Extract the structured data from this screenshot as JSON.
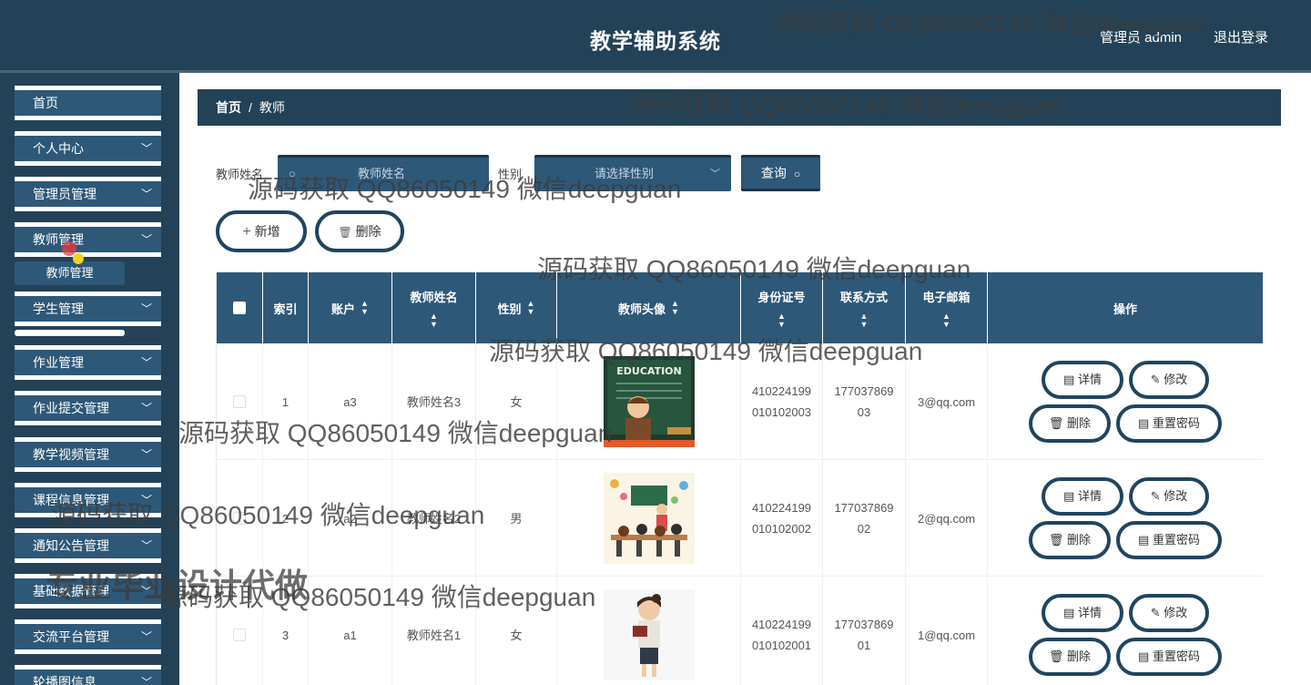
{
  "header": {
    "title": "教学辅助系统",
    "user": "管理员 admin",
    "logout": "退出登录"
  },
  "sidebar": {
    "items": [
      {
        "label": "首页",
        "chevron": false
      },
      {
        "label": "个人中心",
        "chevron": true
      },
      {
        "label": "管理员管理",
        "chevron": true
      },
      {
        "label": "教师管理",
        "chevron": true
      },
      {
        "label": "学生管理",
        "chevron": true
      },
      {
        "label": "作业管理",
        "chevron": true
      },
      {
        "label": "作业提交管理",
        "chevron": true
      },
      {
        "label": "教学视频管理",
        "chevron": true
      },
      {
        "label": "课程信息管理",
        "chevron": true
      },
      {
        "label": "通知公告管理",
        "chevron": true
      },
      {
        "label": "基础数据管理",
        "chevron": true
      },
      {
        "label": "交流平台管理",
        "chevron": true
      },
      {
        "label": "轮播图信息",
        "chevron": true
      }
    ],
    "sub_item": "教师管理",
    "chevron_icon": "chevron-down-icon"
  },
  "breadcrumb": {
    "home": "首页",
    "separator": "/",
    "current": "教师"
  },
  "search": {
    "name_label": "教师姓名",
    "name_placeholder": "教师姓名",
    "gender_label": "性别",
    "gender_placeholder": "请选择性别",
    "query_label": "查询"
  },
  "actions": {
    "add_label": "新增",
    "delete_label": "删除"
  },
  "table": {
    "columns": [
      "索引",
      "账户",
      "教师姓名",
      "性别",
      "教师头像",
      "身份证号",
      "联系方式",
      "电子邮箱",
      "操作"
    ],
    "rows": [
      {
        "index": "1",
        "account": "a3",
        "name": "教师姓名3",
        "gender": "女",
        "id_card": "410224199010102003",
        "phone": "17703786903",
        "email": "3@qq.com",
        "avatar": "education-board-teacher"
      },
      {
        "index": "2",
        "account": "a2",
        "name": "教师姓名2",
        "gender": "男",
        "id_card": "410224199010102002",
        "phone": "17703786902",
        "email": "2@qq.com",
        "avatar": "classroom-students"
      },
      {
        "index": "3",
        "account": "a1",
        "name": "教师姓名1",
        "gender": "女",
        "id_card": "410224199010102001",
        "phone": "17703786901",
        "email": "1@qq.com",
        "avatar": "female-teacher-book"
      }
    ],
    "op_labels": {
      "detail": "详情",
      "edit": "修改",
      "delete": "删除",
      "reset": "重置密码"
    },
    "avatar_board_text": "EDUCATION"
  },
  "watermarks": {
    "text": "源码获取 QQ86050149 微信deepguan",
    "big_text": "专业毕业设计代做"
  },
  "colors": {
    "primary": "#234257",
    "secondary": "#2e5878",
    "border": "#1f4560"
  }
}
